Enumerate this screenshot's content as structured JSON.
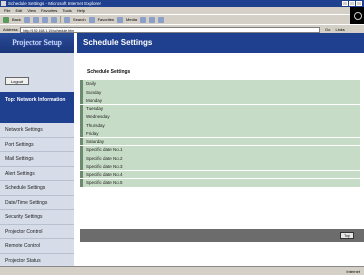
{
  "browser": {
    "title": "Schedule Settings - Microsoft Internet Explorer",
    "menu": [
      "File",
      "Edit",
      "View",
      "Favorites",
      "Tools",
      "Help"
    ],
    "toolbar": [
      "Back",
      "Search",
      "Favorites",
      "Media"
    ],
    "address_label": "Address",
    "address_value": "http://192.168.1.10/schedule.htm",
    "go_label": "Go",
    "links_label": "Links",
    "status_zone": "Internet"
  },
  "sidebar": {
    "logo": "Projector Setup",
    "logout": "Logout",
    "section": "Top: Network Information",
    "items": [
      {
        "label": "Network Settings"
      },
      {
        "label": "Port Settings"
      },
      {
        "label": "Mail Settings"
      },
      {
        "label": "Alert Settings"
      },
      {
        "label": "Schedule Settings"
      },
      {
        "label": "Date/Time Settings"
      },
      {
        "label": "Security Settings"
      },
      {
        "label": "Projector Control"
      },
      {
        "label": "Remote Control"
      },
      {
        "label": "Projector Status"
      }
    ]
  },
  "main": {
    "header": "Schedule Settings",
    "title": "Schedule Settings",
    "rows": [
      {
        "label": "Daily"
      },
      {
        "label": "Sunday"
      },
      {
        "label": "Monday"
      },
      {
        "label": "Tuesday"
      },
      {
        "label": "Wednesday"
      },
      {
        "label": "Thursday"
      },
      {
        "label": "Friday"
      },
      {
        "label": "Saturday"
      },
      {
        "label": "Specific date No.1"
      },
      {
        "label": "Specific date No.2"
      },
      {
        "label": "Specific date No.3"
      },
      {
        "label": "Specific date No.4"
      },
      {
        "label": "Specific date No.5"
      }
    ],
    "top_button": "Top"
  },
  "colors": {
    "nav_blue": "#1f3f8f",
    "row_green": "#c7dcc6",
    "sidebar_bg": "#d7dde8"
  }
}
